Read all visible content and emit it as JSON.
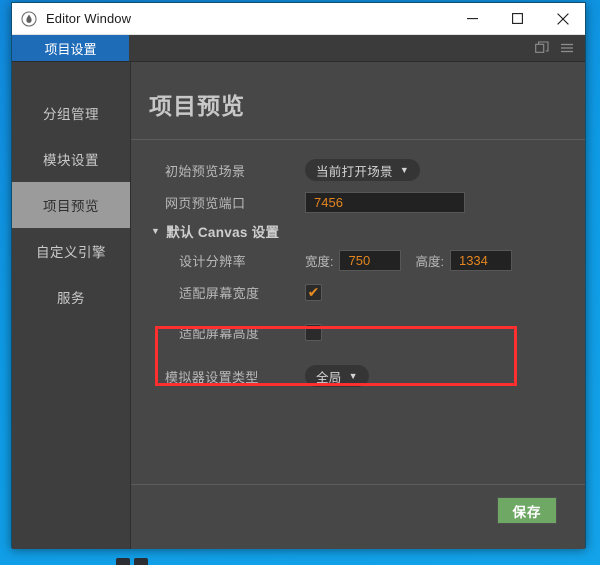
{
  "window": {
    "title": "Editor Window",
    "app_icon": "droplet-icon",
    "controls": {
      "minimize": "—",
      "maximize": "☐",
      "close": "✕"
    }
  },
  "tabs": [
    {
      "label": "项目设置",
      "active": true
    }
  ],
  "tab_tools": [
    {
      "name": "popout-window-icon"
    },
    {
      "name": "hamburger-menu-icon"
    }
  ],
  "sidebar": {
    "items": [
      {
        "label": "分组管理",
        "active": false
      },
      {
        "label": "模块设置",
        "active": false
      },
      {
        "label": "项目预览",
        "active": true
      },
      {
        "label": "自定义引擎",
        "active": false
      },
      {
        "label": "服务",
        "active": false
      }
    ]
  },
  "main": {
    "page_title": "项目预览",
    "fields": {
      "initial_scene_label": "初始预览场景",
      "initial_scene_value": "当前打开场景",
      "preview_port_label": "网页预览端口",
      "preview_port_value": "7456",
      "canvas_section_label": "默认 Canvas 设置",
      "design_resolution_label": "设计分辨率",
      "width_label": "宽度:",
      "width_value": "750",
      "height_label": "高度:",
      "height_value": "1334",
      "fit_width_label": "适配屏幕宽度",
      "fit_width_checked": true,
      "fit_height_label": "适配屏幕高度",
      "fit_height_checked": false,
      "simulator_type_label": "模拟器设置类型",
      "simulator_type_value": "全局"
    },
    "save_label": "保存"
  },
  "glyphs": {
    "caret_down": "▼",
    "triangle_down": "▼",
    "check": "✔"
  },
  "colors": {
    "desktop_blue": "#0e9ae5",
    "tab_active_blue": "#1e6bb8",
    "panel_bg": "#474747",
    "sidebar_bg": "#3e3e3e",
    "sidebar_active": "#9b9b9b",
    "input_text_orange": "#e4861f",
    "save_green": "#6fa765",
    "annotation_red": "#fe2f2f"
  }
}
